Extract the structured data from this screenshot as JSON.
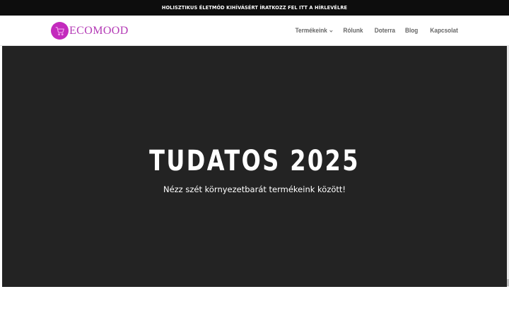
{
  "topbar": {
    "announcement": "HOLISZTIKUS ÉLETMÓD KIHÍVÁSÉRT ÍRATKOZZ FEL ITT A HÍRLEVÉLRE"
  },
  "header": {
    "logo": {
      "text": "ECOMOOD",
      "icon": "shopping-cart-icon",
      "color": "#c32bbd"
    },
    "nav": [
      {
        "label": "Termékeink",
        "has_dropdown": true,
        "dropdown_icon": "chevron-down-icon"
      },
      {
        "label": "Rólunk"
      },
      {
        "label": "Doterra"
      },
      {
        "label": "Blog"
      },
      {
        "label": "Kapcsolat"
      }
    ]
  },
  "hero": {
    "title": "TUDATOS 2025",
    "subtitle": "Nézz szét környezetbarát termékeink között!",
    "background": "#232323"
  }
}
